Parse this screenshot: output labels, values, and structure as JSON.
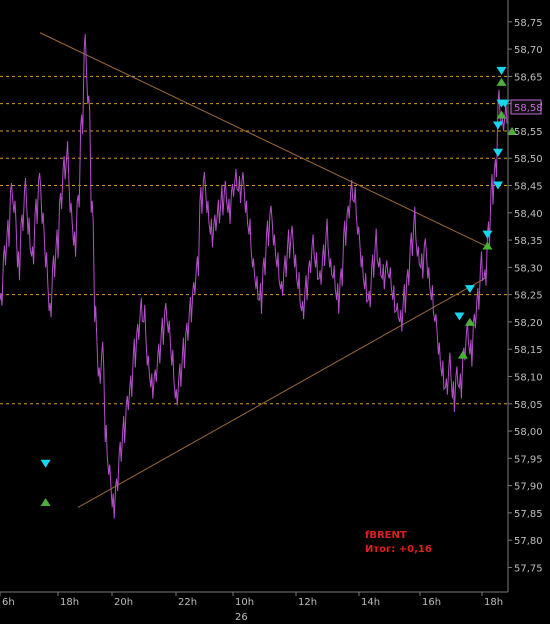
{
  "colors": {
    "background": "#000000",
    "price_line": "#b350c9",
    "level_line": "#d89a1e",
    "trend_line": "#9c6a3a",
    "axis": "#7a7a7a",
    "tick_text": "#bdbdbd",
    "buy_marker": "#4caf3c",
    "sell_marker": "#19d6f0",
    "annotation": "#e02020"
  },
  "annotation": {
    "symbol": "fBRENT",
    "result": "Итог: +0,16"
  },
  "last_price_label": "58,58",
  "chart_data": {
    "type": "line",
    "series": [
      {
        "values": [
          58.24,
          58.32,
          58.36,
          58.44,
          58.4,
          58.3,
          58.38,
          58.44,
          58.36,
          58.32,
          58.4,
          58.46,
          58.38,
          58.3,
          58.22,
          58.3,
          58.34,
          58.42,
          58.48,
          58.5,
          58.4,
          58.34,
          58.42,
          58.56,
          58.7,
          58.6,
          58.4,
          58.2,
          58.1,
          58.14,
          57.98,
          57.92,
          57.86,
          57.9,
          57.96,
          58.0,
          58.05,
          58.08,
          58.14,
          58.18,
          58.22,
          58.2,
          58.12,
          58.08,
          58.1,
          58.14,
          58.18,
          58.22,
          58.18,
          58.12,
          58.06,
          58.1,
          58.14,
          58.18,
          58.22,
          58.26,
          58.3,
          58.42,
          58.46,
          58.4,
          58.36,
          58.38,
          58.4,
          58.42,
          58.44,
          58.4,
          58.44,
          58.46,
          58.44,
          58.46,
          58.4,
          58.36,
          58.3,
          58.26,
          58.24,
          58.3,
          58.36,
          58.4,
          58.34,
          58.3,
          58.26,
          58.3,
          58.34,
          58.36,
          58.3,
          58.26,
          58.22,
          58.26,
          58.3,
          58.34,
          58.3,
          58.28,
          58.32,
          58.36,
          58.3,
          58.28,
          58.24,
          58.28,
          58.36,
          58.4,
          58.44,
          58.42,
          58.36,
          58.3,
          58.26,
          58.24,
          58.3,
          58.34,
          58.3,
          58.28,
          58.3,
          58.28,
          58.24,
          58.22,
          58.2,
          58.24,
          58.28,
          58.34,
          58.38,
          58.32,
          58.3,
          58.34,
          58.28,
          58.24,
          58.2,
          58.14,
          58.1,
          58.08,
          58.12,
          58.06,
          58.1,
          58.08,
          58.14,
          58.18,
          58.14,
          58.2,
          58.24,
          58.3,
          58.28,
          58.36,
          58.44,
          58.48,
          58.6,
          58.56,
          58.58
        ]
      }
    ],
    "x_ticks": [
      "6h",
      "18h",
      "20h",
      "22h",
      "10h",
      "12h",
      "14h",
      "16h",
      "18h"
    ],
    "x_secondary_label": "26",
    "y_ticks": [
      "58,75",
      "58,70",
      "58,65",
      "58,60",
      "58,55",
      "58,50",
      "58,45",
      "58,40",
      "58,35",
      "58,30",
      "58,25",
      "58,20",
      "58,15",
      "58,10",
      "58,05",
      "58,00",
      "57,95",
      "57,90",
      "57,85",
      "57,80",
      "57,75"
    ],
    "ylim": [
      57.7,
      58.79
    ],
    "horizontal_levels": [
      58.65,
      58.6,
      58.55,
      58.5,
      58.45,
      58.25,
      58.05
    ],
    "trendlines": [
      {
        "from": [
          40,
          58.73
        ],
        "to": [
          485,
          58.34
        ]
      },
      {
        "from": [
          78,
          57.86
        ],
        "to": [
          485,
          58.28
        ]
      }
    ],
    "buy_markers": [
      {
        "x": 13,
        "y": 57.87
      },
      {
        "x": 132,
        "y": 58.14
      },
      {
        "x": 134,
        "y": 58.2
      },
      {
        "x": 139,
        "y": 58.34
      },
      {
        "x": 143,
        "y": 58.58
      },
      {
        "x": 143,
        "y": 58.64
      },
      {
        "x": 146,
        "y": 58.55
      }
    ],
    "sell_markers": [
      {
        "x": 13,
        "y": 57.94
      },
      {
        "x": 131,
        "y": 58.21
      },
      {
        "x": 134,
        "y": 58.26
      },
      {
        "x": 139,
        "y": 58.36
      },
      {
        "x": 142,
        "y": 58.45
      },
      {
        "x": 142,
        "y": 58.51
      },
      {
        "x": 142,
        "y": 58.56
      },
      {
        "x": 143,
        "y": 58.6
      },
      {
        "x": 144,
        "y": 58.6
      },
      {
        "x": 143,
        "y": 58.66
      }
    ]
  }
}
